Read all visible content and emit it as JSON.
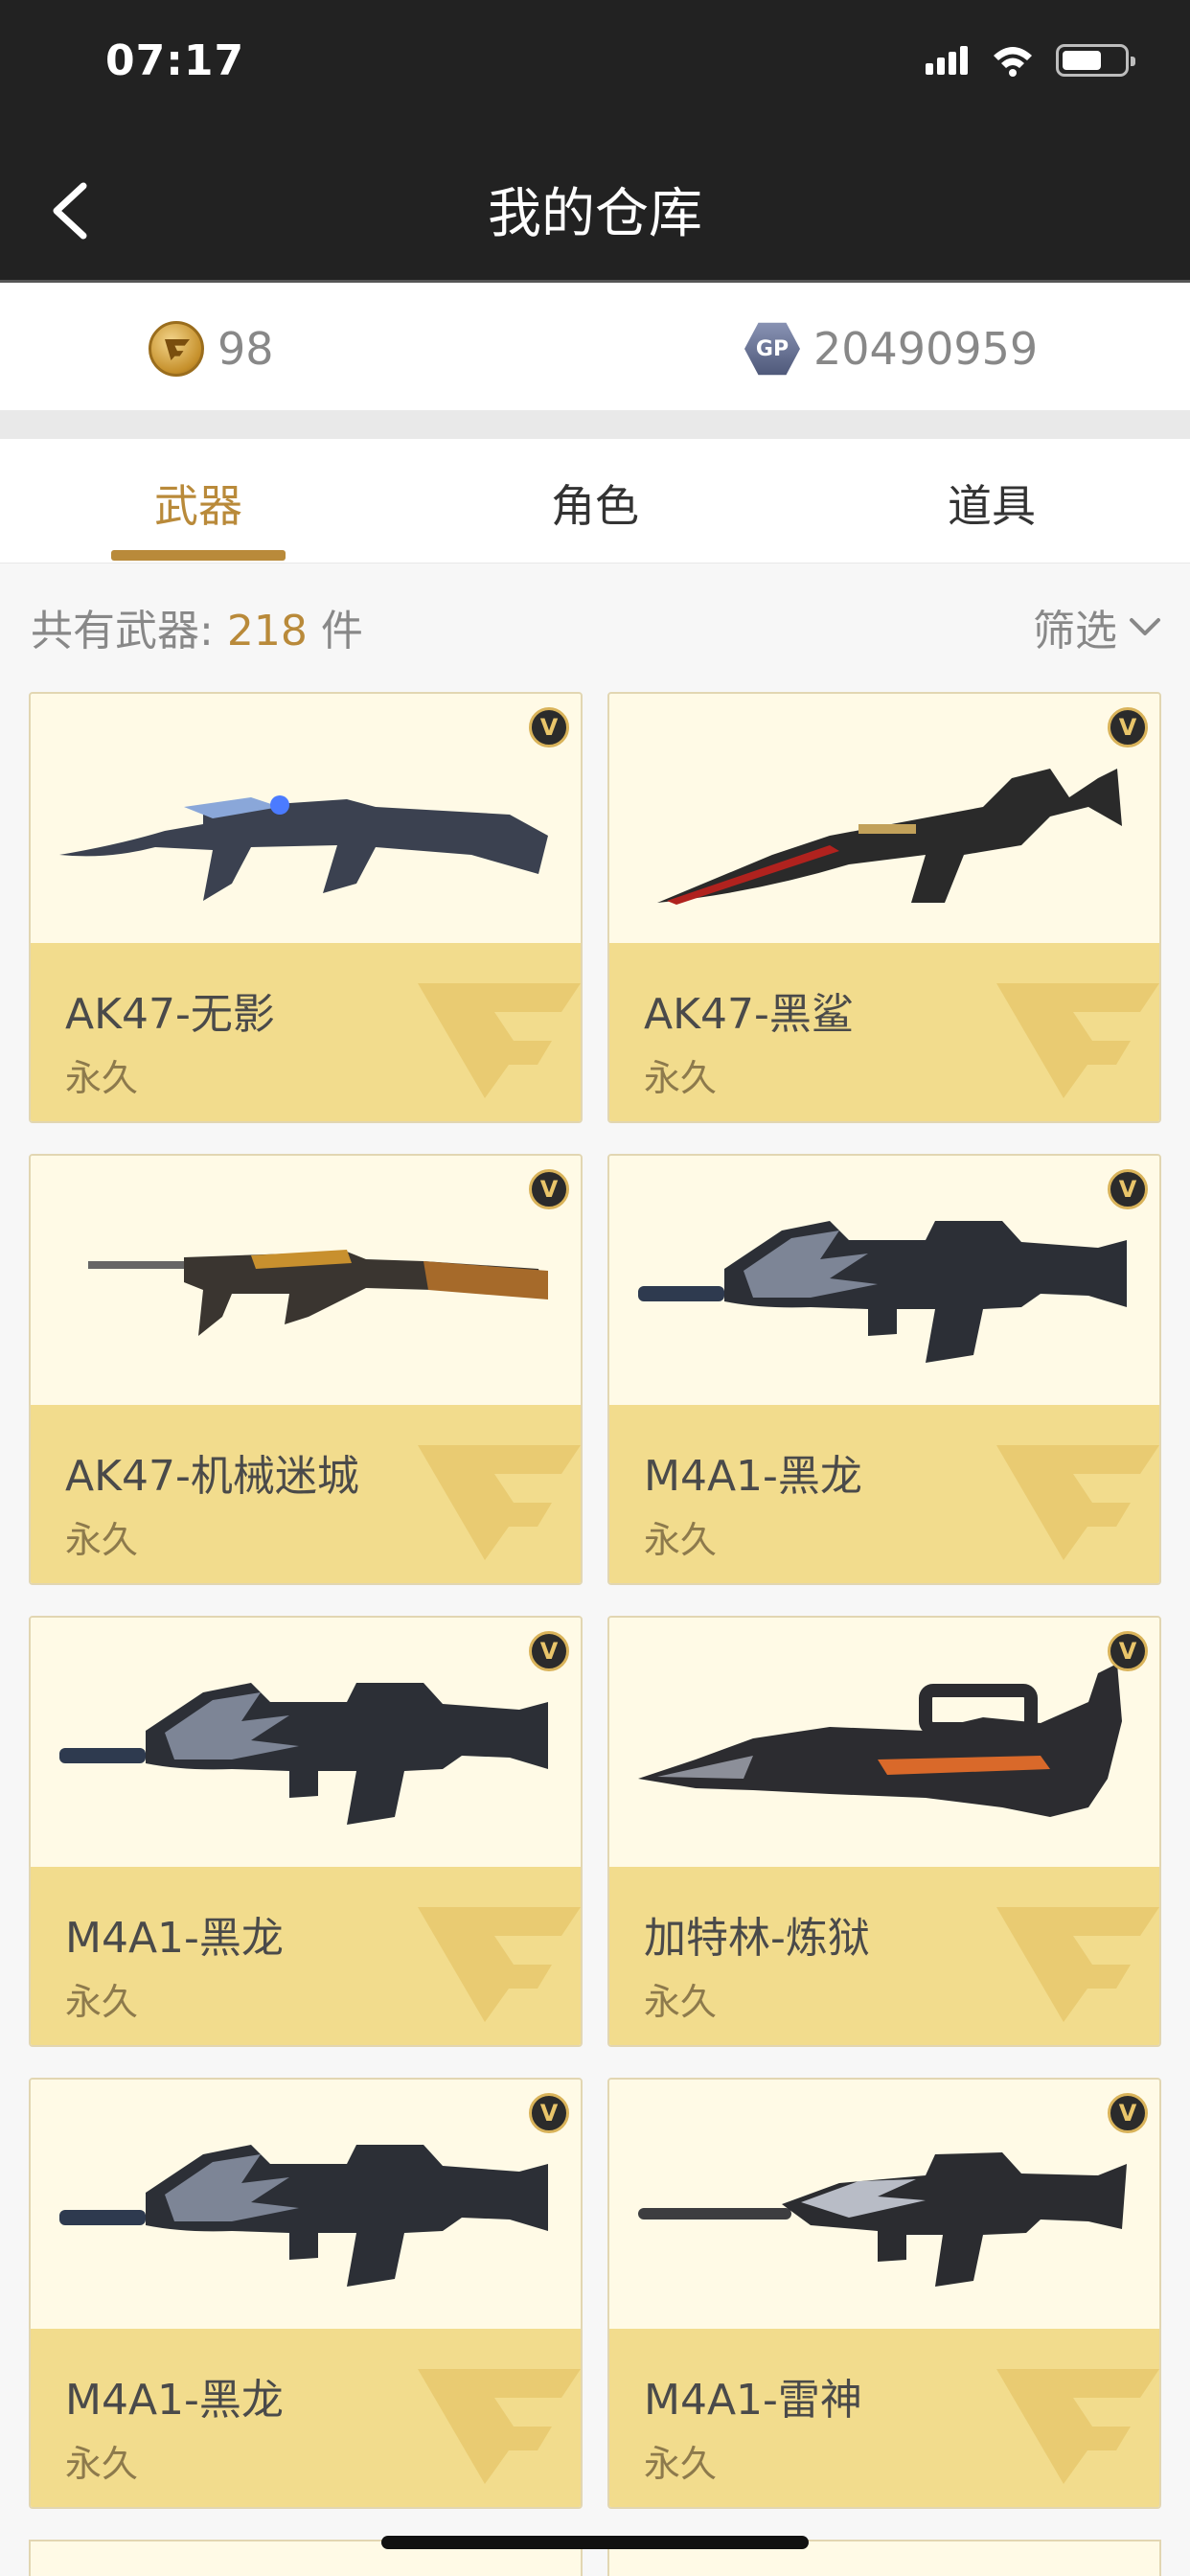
{
  "status_bar": {
    "time": "07:17"
  },
  "nav": {
    "title": "我的仓库"
  },
  "currency": {
    "cf_amount": "98",
    "gp_label": "GP",
    "gp_amount": "20490959"
  },
  "tabs": [
    {
      "label": "武器",
      "active": true
    },
    {
      "label": "角色",
      "active": false
    },
    {
      "label": "道具",
      "active": false
    }
  ],
  "summary": {
    "label": "共有武器:",
    "count": "218",
    "unit": "件",
    "filter_label": "筛选"
  },
  "badge_letter": "V",
  "colors": {
    "accent": "#b98a3a",
    "card_bg": "#fffae6",
    "card_info": "#f2dc8d",
    "header": "#222222"
  },
  "items": [
    {
      "name": "AK47-无影",
      "duration": "永久",
      "gun": "ak-dark"
    },
    {
      "name": "AK47-黑鲨",
      "duration": "永久",
      "gun": "ak-red"
    },
    {
      "name": "AK47-机械迷城",
      "duration": "永久",
      "gun": "ak-wood"
    },
    {
      "name": "M4A1-黑龙",
      "duration": "永久",
      "gun": "m4-dragon"
    },
    {
      "name": "M4A1-黑龙",
      "duration": "永久",
      "gun": "m4-dragon"
    },
    {
      "name": "加特林-炼狱",
      "duration": "永久",
      "gun": "gatling"
    },
    {
      "name": "M4A1-黑龙",
      "duration": "永久",
      "gun": "m4-dragon"
    },
    {
      "name": "M4A1-雷神",
      "duration": "永久",
      "gun": "m4-silver"
    }
  ]
}
